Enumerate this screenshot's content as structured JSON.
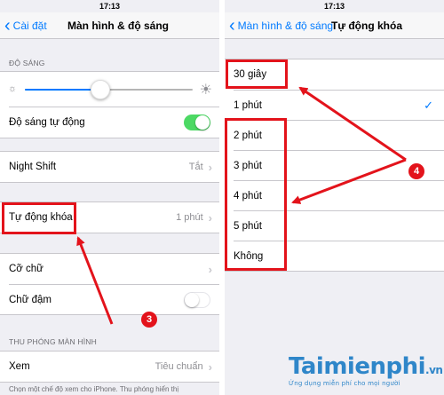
{
  "left": {
    "time": "17:13",
    "back_label": "Cài đặt",
    "title": "Màn hình & độ sáng",
    "brightness_header": "ĐỘ SÁNG",
    "brightness_level": 0.45,
    "auto_brightness_label": "Độ sáng tự động",
    "auto_brightness_on": true,
    "night_shift_label": "Night Shift",
    "night_shift_value": "Tắt",
    "auto_lock_label": "Tự động khóa",
    "auto_lock_value": "1 phút",
    "text_size_label": "Cỡ chữ",
    "bold_text_label": "Chữ đậm",
    "bold_text_on": false,
    "zoom_header": "THU PHÓNG MÀN HÌNH",
    "view_label": "Xem",
    "view_value": "Tiêu chuẩn",
    "footer_note": "Chọn một chế độ xem cho iPhone. Thu phóng hiển thị"
  },
  "right": {
    "time": "17:13",
    "back_label": "Màn hình & độ sáng",
    "title": "Tự động khóa",
    "options": [
      "30 giây",
      "1 phút",
      "2 phút",
      "3 phút",
      "4 phút",
      "5 phút",
      "Không"
    ],
    "selected": "1 phút"
  },
  "annotations": {
    "step_left": "3",
    "step_right": "4",
    "color": "#e3131b"
  },
  "watermark": {
    "brand": "Taimienphi",
    "suffix": ".vn",
    "tagline": "Ứng dụng miễn phí cho mọi người"
  },
  "icons": {
    "back": "chevron-left-icon",
    "disclosure": "chevron-right-icon",
    "check": "checkmark-icon",
    "sun_small": "sun-small-icon",
    "sun_large": "sun-large-icon"
  },
  "colors": {
    "ios_blue": "#007aff",
    "toggle_green": "#4cd964",
    "background": "#efeff4"
  }
}
